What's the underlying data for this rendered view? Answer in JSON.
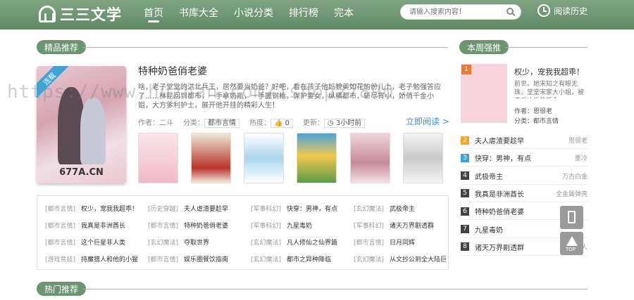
{
  "header": {
    "logo": "三三文学",
    "nav": [
      "首页",
      "书库大全",
      "小说分类",
      "排行榜",
      "完本"
    ],
    "search_placeholder": "请输入搜索内容！",
    "history": "阅读历史"
  },
  "featured": {
    "section": "精品推荐",
    "ribbon": "连载",
    "cover_text": "677A.CN",
    "title": "特种奶爸俏老婆",
    "desc": "啥，老子堂堂的洪北兵王，居然要当奶爸？好吧，看在孩子他妈貌美如花的份儿上，老子勉强答应了……林昆回到都市，一手拿奶瓶，一手握钢枪，保护妻女，纵横都市，斩尽宵小，娇俏千金小姐，大方爹利护士，展开他开挂的精彩人生！",
    "author": "作者：二斗",
    "genre_label": "分类：",
    "genre": "都市言情",
    "heat_label": "热度：",
    "heat": "0",
    "update_label": "更新：",
    "update": "3小时前",
    "read_now": "立即阅读 >"
  },
  "watermark": "https://www.huzhan.com/1shop27890",
  "links": [
    [
      [
        "[都市言情]",
        "权少，宠我我超乖！"
      ],
      [
        "[历史穿越]",
        "夫人虐渣要趁早"
      ],
      [
        "[军事科幻]",
        "快穿：男神，有点"
      ],
      [
        "[玄幻魔法]",
        "武极帝主"
      ]
    ],
    [
      [
        "[都市言情]",
        "我真是非洲酋长"
      ],
      [
        "[都市言情]",
        "特种奶爸俏老婆"
      ],
      [
        "[军事科幻]",
        "九星毒奶"
      ],
      [
        "[军事科幻]",
        "诸天万界剧透群"
      ]
    ],
    [
      [
        "[都市言情]",
        "这个巨星非人类"
      ],
      [
        "[玄幻魔法]",
        "夺取世界"
      ],
      [
        "[玄幻魔法]",
        "凡人修仙之仙界篇"
      ],
      [
        "[都市言情]",
        "日月同辉"
      ]
    ],
    [
      [
        "[游戏竞技]",
        "持魔猎人和他的小猩"
      ],
      [
        "[都市言情]",
        "娱乐圈餐饮指南"
      ],
      [
        "[玄幻魔法]",
        "都市之异种降临"
      ],
      [
        "[玄幻魔法]",
        "从文抄公到全大陆巨"
      ]
    ]
  ],
  "weekly": {
    "section": "本周强推",
    "top": {
      "rank": "1",
      "title": "权少，宠我我超乖！",
      "desc": "前世。她宋知之有眼无珠，堂堂宋家大小姐，被恋爱冲昏的千金，",
      "author": "作者：恩很老",
      "genre": "分类：都市言情"
    },
    "list": [
      {
        "rank": "2",
        "name": "夫人虐渣要趁早",
        "author": "恩很老",
        "color": "#f2a62e"
      },
      {
        "rank": "3",
        "name": "快穿：男神，有点",
        "author": "墨冷",
        "color": "#3da3e0"
      },
      {
        "rank": "4",
        "name": "武极帝主",
        "author": "万古白金",
        "color": "#444444"
      },
      {
        "rank": "5",
        "name": "我真是非洲酋长",
        "author": "全金属弹壳",
        "color": "#444444"
      },
      {
        "rank": "6",
        "name": "特种奶爸俏老婆",
        "author": "",
        "color": "#444444"
      },
      {
        "rank": "7",
        "name": "九星毒奶",
        "author": "",
        "color": "#444444"
      },
      {
        "rank": "8",
        "name": "诸天万界剧透群",
        "author": "槐星上人",
        "color": "#444444"
      }
    ]
  },
  "hot": {
    "section": "热门推荐"
  },
  "float": {
    "top_label": "TOP"
  }
}
